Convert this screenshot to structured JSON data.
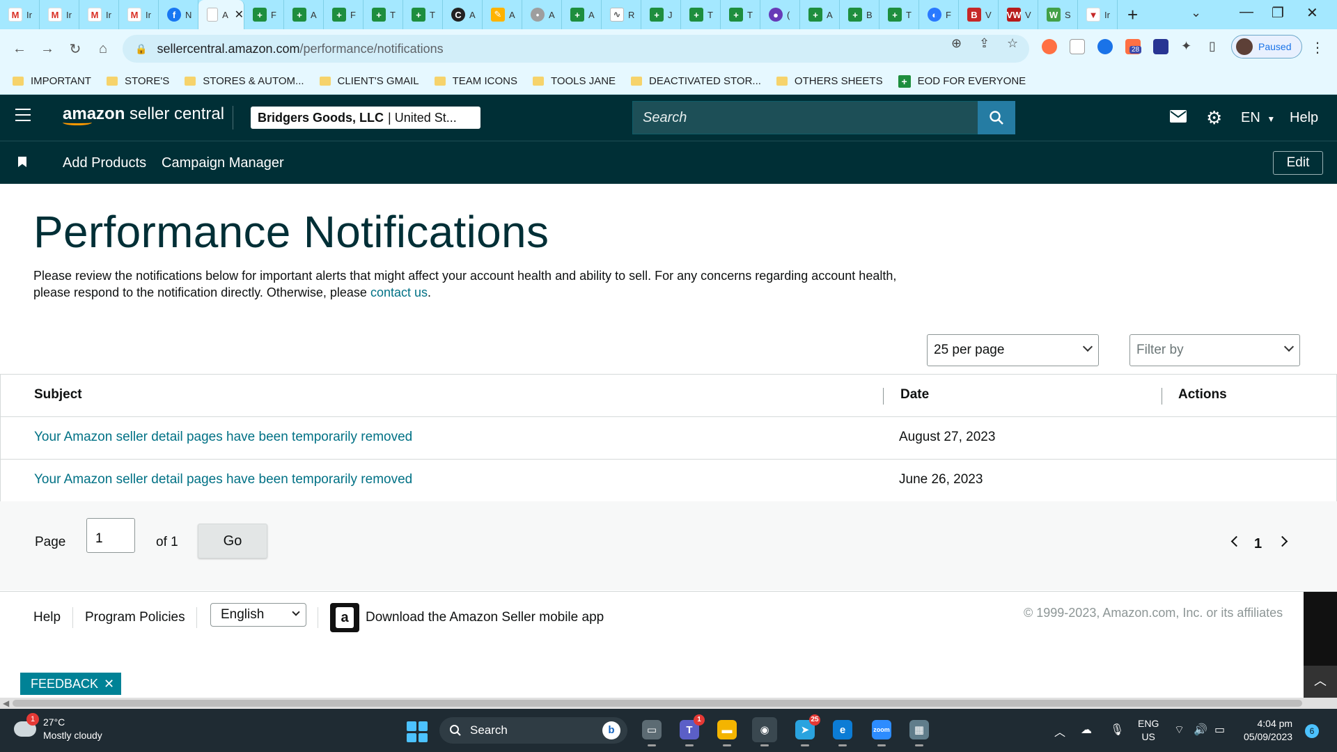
{
  "browser": {
    "tabs": [
      {
        "icon": "gmail-icon",
        "glyph": "M",
        "title": "Ir",
        "style": "gmail"
      },
      {
        "icon": "gmail-icon",
        "glyph": "M",
        "title": "Ir",
        "style": "gmail"
      },
      {
        "icon": "gmail-icon",
        "glyph": "M",
        "title": "Ir",
        "style": "gmail"
      },
      {
        "icon": "gmail-icon",
        "glyph": "M",
        "title": "Ir",
        "style": "gmail"
      },
      {
        "icon": "facebook-icon",
        "glyph": "f",
        "title": "N",
        "style": "fb"
      },
      {
        "icon": "amazon-icon",
        "glyph": "",
        "title": "A",
        "style": "active"
      },
      {
        "icon": "sheets-icon",
        "glyph": "+",
        "title": "F",
        "style": "sheet"
      },
      {
        "icon": "sheets-icon",
        "glyph": "+",
        "title": "A",
        "style": "sheet"
      },
      {
        "icon": "sheets-icon",
        "glyph": "+",
        "title": "F",
        "style": "sheet"
      },
      {
        "icon": "sheets-icon",
        "glyph": "+",
        "title": "T",
        "style": "sheet"
      },
      {
        "icon": "sheets-icon",
        "glyph": "+",
        "title": "T",
        "style": "sheet"
      },
      {
        "icon": "chatgpt-icon",
        "glyph": "C",
        "title": "A",
        "style": "dark"
      },
      {
        "icon": "pen-icon",
        "glyph": "✎",
        "title": "A",
        "style": "pen"
      },
      {
        "icon": "globe-icon",
        "glyph": "•",
        "title": "A",
        "style": "grey"
      },
      {
        "icon": "sheets-icon",
        "glyph": "+",
        "title": "A",
        "style": "sheet"
      },
      {
        "icon": "wave-icon",
        "glyph": "∿",
        "title": "R",
        "style": "wave"
      },
      {
        "icon": "sheets-icon",
        "glyph": "+",
        "title": "J",
        "style": "sheet"
      },
      {
        "icon": "sheets-icon",
        "glyph": "+",
        "title": "T",
        "style": "sheet"
      },
      {
        "icon": "sheets-icon",
        "glyph": "+",
        "title": "T",
        "style": "sheet"
      },
      {
        "icon": "chat-icon",
        "glyph": "●",
        "title": "(",
        "style": "purple"
      },
      {
        "icon": "sheets-icon",
        "glyph": "+",
        "title": "A",
        "style": "sheet"
      },
      {
        "icon": "sheets-icon",
        "glyph": "+",
        "title": "B",
        "style": "sheet"
      },
      {
        "icon": "sheets-icon",
        "glyph": "+",
        "title": "T",
        "style": "sheet"
      },
      {
        "icon": "blue-logo-icon",
        "glyph": "◐",
        "title": "F",
        "style": "blue"
      },
      {
        "icon": "big-icon",
        "glyph": "B",
        "title": "V",
        "style": "red"
      },
      {
        "icon": "vw-icon",
        "glyph": "VW",
        "title": "V",
        "style": "vw"
      },
      {
        "icon": "w-logo-icon",
        "glyph": "W",
        "title": "S",
        "style": "w"
      },
      {
        "icon": "triangle-icon",
        "glyph": "▼",
        "title": "Ir",
        "style": "tri"
      }
    ],
    "active_tab_title": "A",
    "url_domain": "sellercentral.amazon.com",
    "url_path": "/performance/notifications",
    "profile_label": "Paused",
    "extension_badge": "28",
    "bookmarks": [
      {
        "label": "IMPORTANT",
        "type": "folder"
      },
      {
        "label": "STORE'S",
        "type": "folder"
      },
      {
        "label": "STORES & AUTOM...",
        "type": "folder"
      },
      {
        "label": "CLIENT'S GMAIL",
        "type": "folder"
      },
      {
        "label": "TEAM ICONS",
        "type": "folder"
      },
      {
        "label": "TOOLS JANE",
        "type": "folder"
      },
      {
        "label": "DEACTIVATED STOR...",
        "type": "folder"
      },
      {
        "label": "OTHERS SHEETS",
        "type": "folder"
      },
      {
        "label": "EOD FOR EVERYONE",
        "type": "sheet"
      }
    ]
  },
  "header": {
    "logo_bold": "amazon",
    "logo_rest": " seller central",
    "account_name": "Bridgers Goods, LLC",
    "account_marketplace": "| United St...",
    "search_placeholder": "Search",
    "language": "EN",
    "help": "Help",
    "subnav": [
      "Add Products",
      "Campaign Manager"
    ],
    "edit": "Edit"
  },
  "main": {
    "title": "Performance Notifications",
    "intro_text": "Please review the notifications below for important alerts that might affect your account health and ability to sell. For any concerns regarding account health, please respond to the notification directly. Otherwise, please ",
    "intro_link": "contact us",
    "intro_end": ".",
    "per_page": "25 per page",
    "filter_placeholder": "Filter by",
    "columns": [
      "Subject",
      "Date",
      "Actions"
    ],
    "rows": [
      {
        "subject": "Your Amazon seller detail pages have been temporarily removed",
        "date": "August 27, 2023"
      },
      {
        "subject": "Your Amazon seller detail pages have been temporarily removed",
        "date": "June 26, 2023"
      }
    ],
    "pagination": {
      "page_label": "Page",
      "page_value": "1",
      "of_label": "of 1",
      "go": "Go",
      "current": "1"
    }
  },
  "footer": {
    "links": [
      "Help",
      "Program Policies"
    ],
    "language": "English",
    "app_text": "Download the Amazon Seller mobile app",
    "copyright": "© 1999-2023, Amazon.com, Inc. or its affiliates",
    "feedback": "FEEDBACK",
    "feedback_close": "✕"
  },
  "taskbar": {
    "weather_temp": "27°C",
    "weather_desc": "Mostly cloudy",
    "weather_badge": "1",
    "search": "Search",
    "apps": [
      {
        "name": "file-explorer-icon",
        "glyph": "▭",
        "badge": ""
      },
      {
        "name": "teams-icon",
        "glyph": "T",
        "badge": "1"
      },
      {
        "name": "folder-icon",
        "glyph": "▬",
        "badge": ""
      },
      {
        "name": "chrome-icon",
        "glyph": "◉",
        "badge": ""
      },
      {
        "name": "telegram-icon",
        "glyph": "➤",
        "badge": "25"
      },
      {
        "name": "edge-icon",
        "glyph": "e",
        "badge": ""
      },
      {
        "name": "zoom-icon",
        "glyph": "zoom",
        "badge": ""
      },
      {
        "name": "calculator-icon",
        "glyph": "▦",
        "badge": ""
      }
    ],
    "lang_top": "ENG",
    "lang_bottom": "US",
    "time": "4:04 pm",
    "date": "05/09/2023",
    "notifications": "6"
  },
  "colors": {
    "header_bg": "#002f36",
    "link": "#007185",
    "search_button": "#257ca3",
    "feedback": "#008296"
  }
}
